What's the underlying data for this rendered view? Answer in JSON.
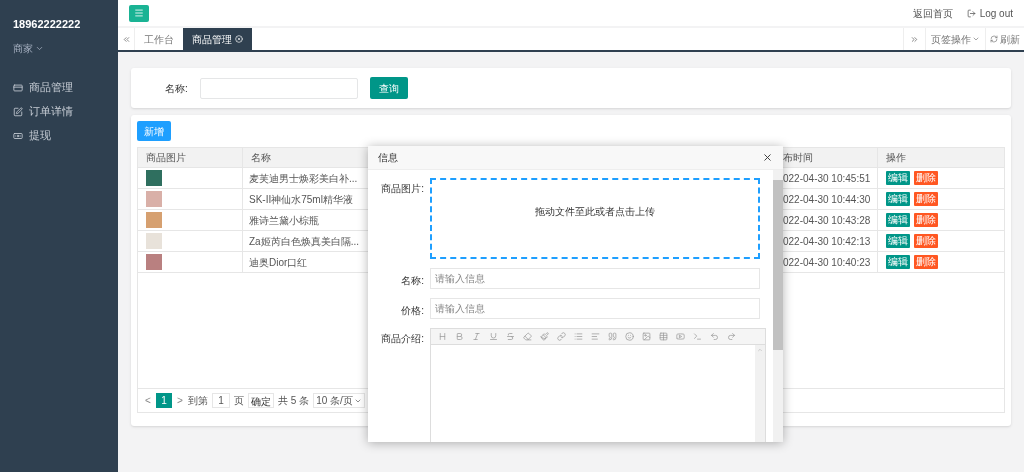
{
  "sidebar": {
    "user": "18962222222",
    "role": "商家",
    "items": [
      {
        "label": "商品管理",
        "selected": false
      },
      {
        "label": "订单详情",
        "selected": false
      },
      {
        "label": "提现",
        "selected": false
      }
    ]
  },
  "topbar": {
    "links": [
      "返回首页",
      "Log out"
    ]
  },
  "tabs": [
    {
      "label": "工作台",
      "selected": false,
      "closable": false
    },
    {
      "label": "商品管理",
      "selected": true,
      "closable": true
    }
  ],
  "tab_actions": [
    "页签操作",
    "刷新"
  ],
  "search": {
    "label": "名称:",
    "button": "查询"
  },
  "add_button": "新增",
  "table": {
    "columns": [
      "商品图片",
      "名称",
      "布时间",
      "操作"
    ],
    "rows": [
      {
        "name": "麦芙迪男士焕彩美白补...",
        "time": "022-04-30 10:45:51",
        "actions": [
          "编辑",
          "删除"
        ]
      },
      {
        "name": "SK-II神仙水75ml精华液",
        "time": "022-04-30 10:44:30",
        "actions": [
          "编辑",
          "删除"
        ]
      },
      {
        "name": "雅诗兰黛小棕瓶",
        "time": "022-04-30 10:43:28",
        "actions": [
          "编辑",
          "删除"
        ]
      },
      {
        "name": "Za姬芮白色焕真美白隔...",
        "time": "022-04-30 10:42:13",
        "actions": [
          "编辑",
          "删除"
        ]
      },
      {
        "name": "迪奥Dior口红",
        "time": "022-04-30 10:40:23",
        "actions": [
          "编辑",
          "删除"
        ]
      }
    ]
  },
  "pagination": {
    "prev": "<",
    "pages": [
      {
        "label": "1",
        "selected": true
      }
    ],
    "next": ">",
    "goto": "到第",
    "goto_value": "1",
    "page_unit": "页",
    "confirm": "确定",
    "total": "共 5 条",
    "page_size": "10 条/页"
  },
  "modal": {
    "title": "信息",
    "fields": [
      {
        "kind": "upload",
        "label": "商品图片:",
        "text": "拖动文件至此或者点击上传"
      },
      {
        "kind": "input",
        "label": "名称:",
        "placeholder": "请输入信息"
      },
      {
        "kind": "input",
        "label": "价格:",
        "placeholder": "请输入信息"
      },
      {
        "kind": "editor",
        "label": "商品介绍:"
      }
    ]
  }
}
